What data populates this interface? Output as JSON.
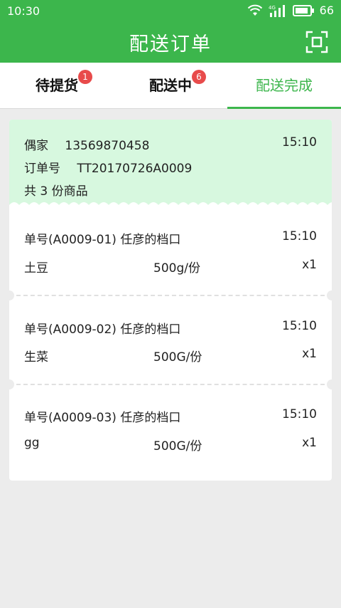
{
  "status": {
    "time": "10:30",
    "battery": "66",
    "network": "4G"
  },
  "header": {
    "title": "配送订单"
  },
  "tabs": [
    {
      "label": "待提货",
      "badge": "1"
    },
    {
      "label": "配送中",
      "badge": "6"
    },
    {
      "label": "配送完成",
      "badge": ""
    }
  ],
  "order": {
    "customer": "偶家",
    "phone": "13569870458",
    "time": "15:10",
    "order_label": "订单号",
    "order_no": "TT20170726A0009",
    "summary": "共 3 份商品"
  },
  "items": [
    {
      "title": "单号(A0009-01)  任彦的档口",
      "time": "15:10",
      "name": "土豆",
      "spec": "500g/份",
      "qty": "x1"
    },
    {
      "title": "单号(A0009-02)  任彦的档口",
      "time": "15:10",
      "name": "生菜",
      "spec": "500G/份",
      "qty": "x1"
    },
    {
      "title": "单号(A0009-03)  任彦的档口",
      "time": "15:10",
      "name": "gg",
      "spec": "500G/份",
      "qty": "x1"
    }
  ],
  "colors": {
    "brand": "#3cb64c",
    "badge": "#e84b4b",
    "header_bg": "#d7f8df"
  }
}
